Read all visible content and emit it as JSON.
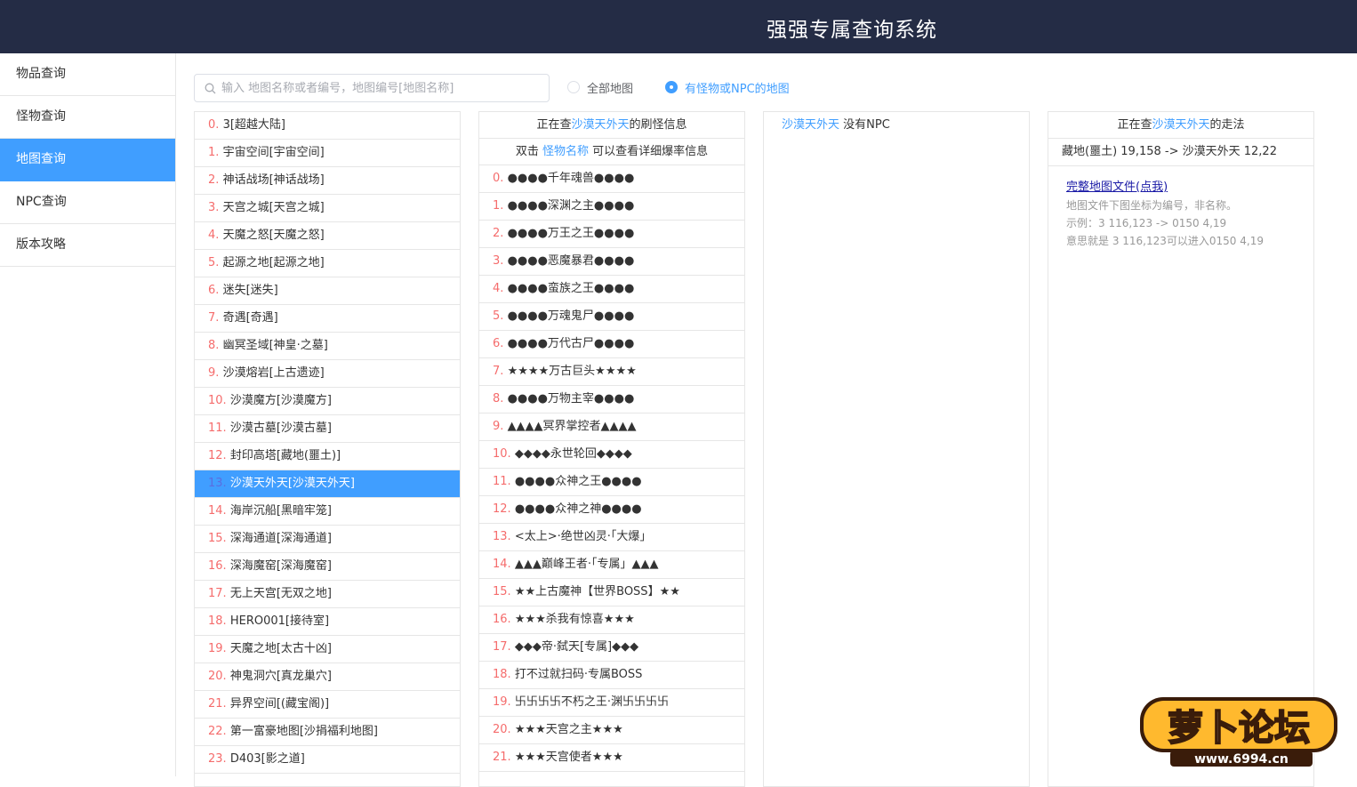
{
  "header": {
    "title": "强强专属查询系统"
  },
  "sidebar": {
    "items": [
      {
        "label": "物品查询",
        "active": false
      },
      {
        "label": "怪物查询",
        "active": false
      },
      {
        "label": "地图查询",
        "active": true
      },
      {
        "label": "NPC查询",
        "active": false
      },
      {
        "label": "版本攻略",
        "active": false
      }
    ]
  },
  "search": {
    "placeholder": "输入 地图名称或者编号，地图编号[地图名称]",
    "value": ""
  },
  "filters": [
    {
      "label": "全部地图",
      "checked": false
    },
    {
      "label": "有怪物或NPC的地图",
      "checked": true
    }
  ],
  "map_list": {
    "selected_index": 13,
    "items": [
      {
        "idx": "0",
        "name": "3[超越大陆]"
      },
      {
        "idx": "1",
        "name": "宇宙空间[宇宙空间]"
      },
      {
        "idx": "2",
        "name": "神话战场[神话战场]"
      },
      {
        "idx": "3",
        "name": "天宫之城[天宫之城]"
      },
      {
        "idx": "4",
        "name": "天魔之怒[天魔之怒]"
      },
      {
        "idx": "5",
        "name": "起源之地[起源之地]"
      },
      {
        "idx": "6",
        "name": "迷失[迷失]"
      },
      {
        "idx": "7",
        "name": "奇遇[奇遇]"
      },
      {
        "idx": "8",
        "name": "幽冥圣域[神皇·之墓]"
      },
      {
        "idx": "9",
        "name": "沙漠熔岩[上古遗迹]"
      },
      {
        "idx": "10",
        "name": "沙漠魔方[沙漠魔方]"
      },
      {
        "idx": "11",
        "name": "沙漠古墓[沙漠古墓]"
      },
      {
        "idx": "12",
        "name": "封印高塔[藏地(噩土)]"
      },
      {
        "idx": "13",
        "name": "沙漠天外天[沙漠天外天]"
      },
      {
        "idx": "14",
        "name": "海岸沉船[黑暗牢笼]"
      },
      {
        "idx": "15",
        "name": "深海通道[深海通道]"
      },
      {
        "idx": "16",
        "name": "深海魔窑[深海魔窑]"
      },
      {
        "idx": "17",
        "name": "无上天宫[无双之地]"
      },
      {
        "idx": "18",
        "name": "HERO001[接待室]"
      },
      {
        "idx": "19",
        "name": "天魔之地[太古十凶]"
      },
      {
        "idx": "20",
        "name": "神鬼洞穴[真龙巢穴]"
      },
      {
        "idx": "21",
        "name": "异界空间[(藏宝阁)]"
      },
      {
        "idx": "22",
        "name": "第一富豪地图[沙捐福利地图]"
      },
      {
        "idx": "23",
        "name": "D403[影之道]"
      }
    ]
  },
  "monster_panel": {
    "header_prefix": "正在查",
    "map_name": "沙漠天外天",
    "header_suffix": "的刷怪信息",
    "hint_prefix": "双击",
    "hint_link": "怪物名称",
    "hint_suffix": "可以查看详细爆率信息",
    "items": [
      {
        "idx": "0",
        "name": "●●●●千年魂兽●●●●"
      },
      {
        "idx": "1",
        "name": "●●●●深渊之主●●●●"
      },
      {
        "idx": "2",
        "name": "●●●●万王之王●●●●"
      },
      {
        "idx": "3",
        "name": "●●●●恶魔暴君●●●●"
      },
      {
        "idx": "4",
        "name": "●●●●蛮族之王●●●●"
      },
      {
        "idx": "5",
        "name": "●●●●万魂鬼尸●●●●"
      },
      {
        "idx": "6",
        "name": "●●●●万代古尸●●●●"
      },
      {
        "idx": "7",
        "name": "★★★★万古巨头★★★★"
      },
      {
        "idx": "8",
        "name": "●●●●万物主宰●●●●"
      },
      {
        "idx": "9",
        "name": "▲▲▲▲冥界掌控者▲▲▲▲"
      },
      {
        "idx": "10",
        "name": "◆◆◆◆永世轮回◆◆◆◆"
      },
      {
        "idx": "11",
        "name": "●●●●众神之王●●●●"
      },
      {
        "idx": "12",
        "name": "●●●●众神之神●●●●"
      },
      {
        "idx": "13",
        "name": "<太上>·绝世凶灵·「大爆」"
      },
      {
        "idx": "14",
        "name": "▲▲▲巅峰王者·「专属」▲▲▲"
      },
      {
        "idx": "15",
        "name": "★★上古魔神【世界BOSS】★★"
      },
      {
        "idx": "16",
        "name": "★★★杀我有惊喜★★★"
      },
      {
        "idx": "17",
        "name": "◆◆◆帝·弑天[专属]◆◆◆"
      },
      {
        "idx": "18",
        "name": "打不过就扫码·专属BOSS"
      },
      {
        "idx": "19",
        "name": "卐卐卐卐不朽之王·渊卐卐卐卐"
      },
      {
        "idx": "20",
        "name": "★★★天宫之主★★★"
      },
      {
        "idx": "21",
        "name": "★★★天宫使者★★★"
      }
    ]
  },
  "npc_panel": {
    "map_name": "沙漠天外天",
    "suffix": "没有NPC"
  },
  "route_panel": {
    "header_prefix": "正在查",
    "map_name": "沙漠天外天",
    "header_suffix": "的走法",
    "route": "藏地(噩土) 19,158 -> 沙漠天外天 12,22",
    "link": "完整地图文件(点我)",
    "notes": [
      "地图文件下图坐标为编号，非名称。",
      "示例：3 116,123 -> 0150 4,19",
      "意思就是 3 116,123可以进入0150 4,19"
    ]
  },
  "watermark": {
    "text": "萝卜论坛",
    "url": "www.6994.cn"
  }
}
